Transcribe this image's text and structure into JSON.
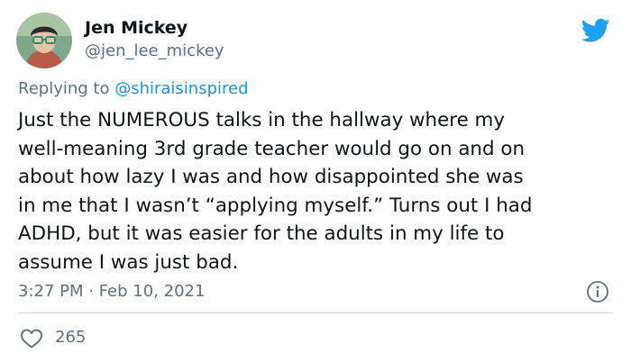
{
  "author": {
    "display_name": "Jen Mickey",
    "handle": "@jen_lee_mickey",
    "avatar_icon": "user-avatar"
  },
  "reply": {
    "prefix": "Replying to ",
    "mention": "@shiraisinspired"
  },
  "body": {
    "lines": [
      "Just the NUMEROUS talks in the hallway where my",
      "well-meaning 3rd grade teacher would go on and on",
      "about how lazy I was and how disappointed she was",
      "in me that I wasn’t “applying myself.” Turns out I had",
      "ADHD, but it was easier for the adults in my life to",
      "assume I was just bad."
    ]
  },
  "meta": {
    "timestamp": "3:27 PM · Feb 10, 2021"
  },
  "stats": {
    "likes": "265"
  },
  "icons": {
    "brand": "twitter-bird-icon",
    "info": "info-icon",
    "like": "heart-icon"
  },
  "colors": {
    "brand_blue": "#1da1f2",
    "link_blue": "#1b95e0",
    "muted_text": "#5b7083",
    "divider": "#cfd9de"
  }
}
